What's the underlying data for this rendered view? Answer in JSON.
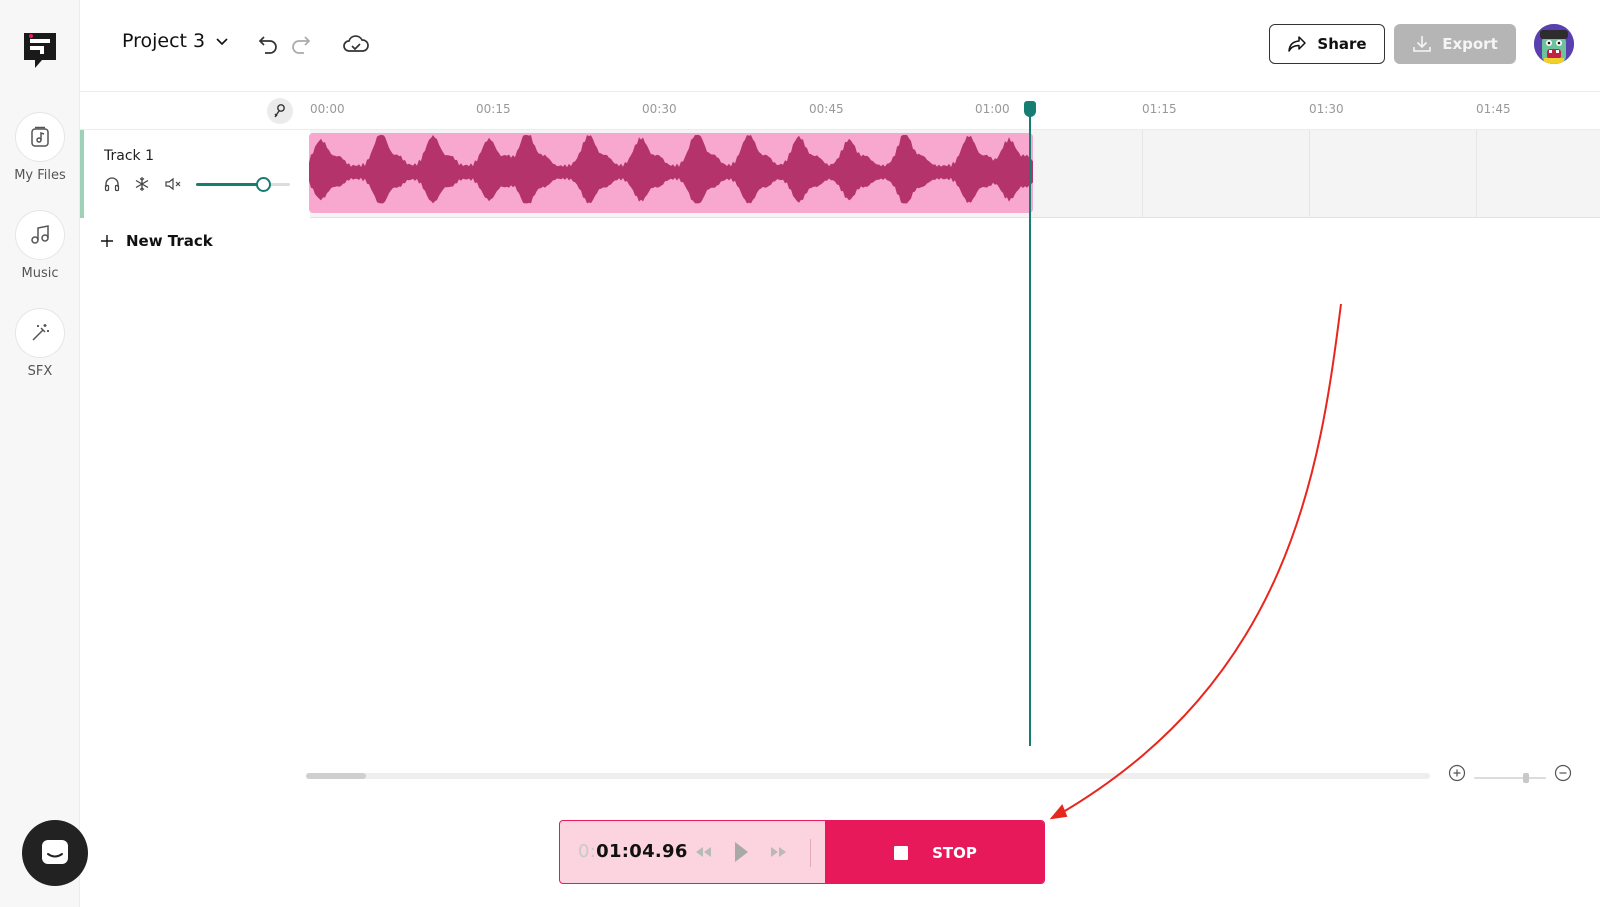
{
  "sidebar": {
    "items": [
      {
        "label": "My Files",
        "icon": "music-file-icon"
      },
      {
        "label": "Music",
        "icon": "music-note-icon"
      },
      {
        "label": "SFX",
        "icon": "magic-wand-icon"
      }
    ]
  },
  "header": {
    "project_title": "Project 3",
    "share_label": "Share",
    "export_label": "Export"
  },
  "ruler": {
    "ticks": [
      "00:00",
      "00:15",
      "00:30",
      "00:45",
      "01:00",
      "01:15",
      "01:30",
      "01:45"
    ]
  },
  "track": {
    "name": "Track 1",
    "volume": 0.72,
    "new_track_label": "New Track"
  },
  "transport": {
    "time_dim": "0:",
    "time": "01:04.96",
    "stop_label": "STOP"
  },
  "colors": {
    "accent": "#167d73",
    "clip": "#f8a8cf",
    "waveform": "#b4336a",
    "stop": "#e8195a",
    "annotation": "#e8261d"
  }
}
